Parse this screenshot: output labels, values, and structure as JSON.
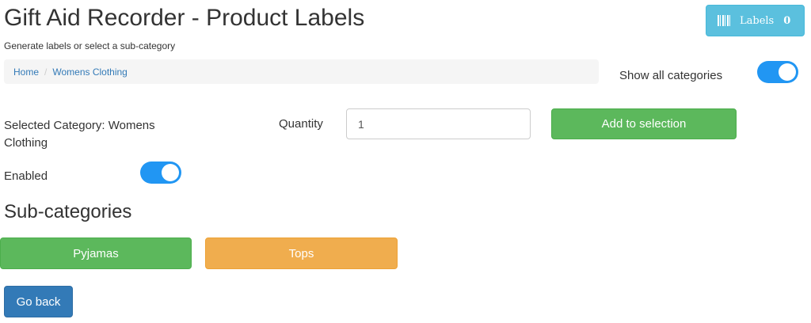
{
  "header": {
    "title": "Gift Aid Recorder - Product Labels",
    "subtitle": "Generate labels or select a sub-category",
    "labels_button": {
      "label": "Labels",
      "count": "0",
      "icon": "barcode-icon",
      "color": "#5bc0de"
    }
  },
  "breadcrumb": [
    {
      "label": "Home"
    },
    {
      "label": "Womens Clothing"
    }
  ],
  "show_all": {
    "label": "Show all categories",
    "enabled": true
  },
  "selection": {
    "selected_category_text": "Selected Category: Womens Clothing",
    "quantity_label": "Quantity",
    "quantity_value": "1",
    "add_button": "Add to selection",
    "enabled_label": "Enabled",
    "enabled": true
  },
  "subcategories": {
    "heading": "Sub-categories",
    "items": [
      {
        "label": "Pyjamas",
        "color": "#5cb85c"
      },
      {
        "label": "Tops",
        "color": "#f0ad4e"
      }
    ]
  },
  "go_back": "Go back",
  "colors": {
    "accent": "#2196f3",
    "primary": "#337ab7",
    "success": "#5cb85c",
    "warning": "#f0ad4e",
    "info": "#5bc0de"
  }
}
